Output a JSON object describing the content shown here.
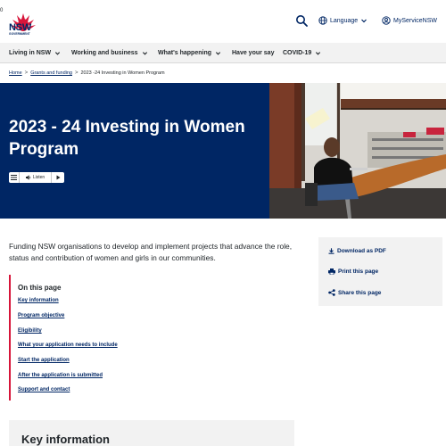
{
  "header": {
    "edge_text": "0",
    "logo_text": "NSW",
    "logo_subtext": "GOVERNMENT",
    "language_label": "Language",
    "myservice_label": "MyServiceNSW"
  },
  "nav": {
    "items": [
      {
        "label": "Living in NSW",
        "has_dropdown": true
      },
      {
        "label": "Working and business",
        "has_dropdown": true
      },
      {
        "label": "What's happening",
        "has_dropdown": true
      },
      {
        "label": "Have your say",
        "has_dropdown": false
      },
      {
        "label": "COVID-19",
        "has_dropdown": true
      }
    ]
  },
  "breadcrumb": {
    "items": [
      "Home",
      "Grants and funding",
      "2023 -24 Investing in Women Program"
    ],
    "separator": ">"
  },
  "hero": {
    "title": "2023 - 24 Investing in Women Program",
    "listen_label": "Listen",
    "background_color": "#002664"
  },
  "intro": {
    "text": "Funding NSW organisations to develop and implement projects that advance the role, status and contribution of women and girls in our communities."
  },
  "on_this_page": {
    "title": "On this page",
    "links": [
      "Key information",
      "Program objective",
      "Eligibility",
      "What your application needs to include",
      "Start the application",
      "After the application is submitted",
      "Support and contact"
    ],
    "accent_color": "#d7153a"
  },
  "side_actions": [
    {
      "label": "Download as PDF",
      "icon": "download-icon"
    },
    {
      "label": "Print this page",
      "icon": "print-icon"
    },
    {
      "label": "Share this page",
      "icon": "share-icon"
    }
  ],
  "key_information": {
    "title": "Key information"
  },
  "colors": {
    "brand_navy": "#002664",
    "brand_red": "#d7153a",
    "panel_grey": "#f2f2f2"
  }
}
